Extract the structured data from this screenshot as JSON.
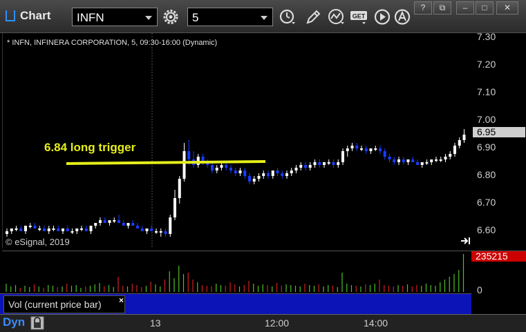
{
  "titlebar": {
    "app_title": "Chart",
    "symbol_value": "INFN",
    "interval_value": "5",
    "get_label": "GET",
    "buttons": [
      "?",
      "⧉",
      "–",
      "□",
      "✕"
    ]
  },
  "chart": {
    "header": "* INFN, INFINERA CORPORATION, 5, 09:30-16:00 (Dynamic)",
    "annotation": "6.84 long trigger",
    "copyright": "© eSignal, 2019",
    "last_price": "6.95",
    "y_ticks": [
      "7.30",
      "7.20",
      "7.10",
      "7.00",
      "6.90",
      "6.80",
      "6.70",
      "6.60"
    ],
    "x_ticks": [
      "13",
      "12:00",
      "14:00"
    ],
    "colors": {
      "up": "#ffffff",
      "down": "#1a3cff",
      "trigger": "#e6ef1a",
      "vol_up": "#4fc22b",
      "vol_down": "#d42020",
      "panel": "#0c14b8"
    }
  },
  "volume": {
    "label": "Vol (current price bar)",
    "last_value": "235215",
    "zero_label": "0"
  },
  "statusbar": {
    "mode": "Dyn"
  },
  "chart_data": {
    "type": "candlestick",
    "price_range": [
      6.55,
      7.32
    ],
    "series": [
      {
        "name": "INFN",
        "values": [
          [
            6.59,
            6.61,
            6.58,
            6.6
          ],
          [
            6.6,
            6.61,
            6.59,
            6.61
          ],
          [
            6.61,
            6.62,
            6.6,
            6.61
          ],
          [
            6.61,
            6.62,
            6.6,
            6.6
          ],
          [
            6.6,
            6.62,
            6.59,
            6.62
          ],
          [
            6.62,
            6.63,
            6.61,
            6.62
          ],
          [
            6.62,
            6.63,
            6.61,
            6.61
          ],
          [
            6.61,
            6.62,
            6.6,
            6.61
          ],
          [
            6.61,
            6.62,
            6.6,
            6.6
          ],
          [
            6.6,
            6.62,
            6.59,
            6.61
          ],
          [
            6.61,
            6.62,
            6.6,
            6.61
          ],
          [
            6.61,
            6.62,
            6.6,
            6.6
          ],
          [
            6.6,
            6.61,
            6.59,
            6.61
          ],
          [
            6.61,
            6.62,
            6.6,
            6.6
          ],
          [
            6.6,
            6.61,
            6.59,
            6.6
          ],
          [
            6.6,
            6.61,
            6.59,
            6.61
          ],
          [
            6.61,
            6.62,
            6.6,
            6.61
          ],
          [
            6.61,
            6.62,
            6.6,
            6.6
          ],
          [
            6.6,
            6.62,
            6.59,
            6.62
          ],
          [
            6.62,
            6.63,
            6.61,
            6.63
          ],
          [
            6.63,
            6.65,
            6.62,
            6.64
          ],
          [
            6.64,
            6.65,
            6.63,
            6.63
          ],
          [
            6.63,
            6.64,
            6.62,
            6.64
          ],
          [
            6.64,
            6.65,
            6.63,
            6.64
          ],
          [
            6.64,
            6.66,
            6.63,
            6.63
          ],
          [
            6.63,
            6.64,
            6.62,
            6.62
          ],
          [
            6.62,
            6.63,
            6.61,
            6.63
          ],
          [
            6.63,
            6.64,
            6.62,
            6.62
          ],
          [
            6.62,
            6.63,
            6.61,
            6.61
          ],
          [
            6.61,
            6.62,
            6.6,
            6.6
          ],
          [
            6.6,
            6.61,
            6.59,
            6.61
          ],
          [
            6.61,
            6.62,
            6.6,
            6.6
          ],
          [
            6.6,
            6.61,
            6.59,
            6.6
          ],
          [
            6.6,
            6.61,
            6.58,
            6.6
          ],
          [
            6.6,
            6.61,
            6.58,
            6.59
          ],
          [
            6.59,
            6.66,
            6.58,
            6.65
          ],
          [
            6.65,
            6.75,
            6.64,
            6.72
          ],
          [
            6.72,
            6.8,
            6.7,
            6.79
          ],
          [
            6.79,
            6.92,
            6.78,
            6.89
          ],
          [
            6.89,
            6.93,
            6.84,
            6.86
          ],
          [
            6.86,
            6.89,
            6.83,
            6.84
          ],
          [
            6.84,
            6.88,
            6.83,
            6.87
          ],
          [
            6.87,
            6.88,
            6.84,
            6.85
          ],
          [
            6.85,
            6.86,
            6.83,
            6.84
          ],
          [
            6.84,
            6.85,
            6.81,
            6.82
          ],
          [
            6.82,
            6.84,
            6.81,
            6.83
          ],
          [
            6.83,
            6.85,
            6.82,
            6.84
          ],
          [
            6.84,
            6.85,
            6.82,
            6.83
          ],
          [
            6.83,
            6.84,
            6.81,
            6.82
          ],
          [
            6.82,
            6.83,
            6.8,
            6.81
          ],
          [
            6.81,
            6.83,
            6.8,
            6.82
          ],
          [
            6.82,
            6.83,
            6.79,
            6.8
          ],
          [
            6.8,
            6.81,
            6.77,
            6.78
          ],
          [
            6.78,
            6.8,
            6.77,
            6.79
          ],
          [
            6.79,
            6.81,
            6.78,
            6.8
          ],
          [
            6.8,
            6.82,
            6.79,
            6.81
          ],
          [
            6.81,
            6.82,
            6.79,
            6.8
          ],
          [
            6.8,
            6.82,
            6.79,
            6.82
          ],
          [
            6.82,
            6.83,
            6.8,
            6.81
          ],
          [
            6.81,
            6.82,
            6.79,
            6.8
          ],
          [
            6.8,
            6.82,
            6.79,
            6.81
          ],
          [
            6.81,
            6.83,
            6.8,
            6.82
          ],
          [
            6.82,
            6.84,
            6.81,
            6.83
          ],
          [
            6.83,
            6.85,
            6.82,
            6.84
          ],
          [
            6.84,
            6.85,
            6.82,
            6.83
          ],
          [
            6.83,
            6.85,
            6.82,
            6.84
          ],
          [
            6.84,
            6.86,
            6.83,
            6.85
          ],
          [
            6.85,
            6.86,
            6.83,
            6.84
          ],
          [
            6.84,
            6.85,
            6.83,
            6.85
          ],
          [
            6.85,
            6.86,
            6.84,
            6.85
          ],
          [
            6.85,
            6.86,
            6.83,
            6.84
          ],
          [
            6.84,
            6.86,
            6.83,
            6.85
          ],
          [
            6.85,
            6.9,
            6.84,
            6.89
          ],
          [
            6.89,
            6.91,
            6.87,
            6.9
          ],
          [
            6.9,
            6.92,
            6.89,
            6.91
          ],
          [
            6.91,
            6.92,
            6.89,
            6.9
          ],
          [
            6.9,
            6.91,
            6.89,
            6.9
          ],
          [
            6.9,
            6.91,
            6.88,
            6.89
          ],
          [
            6.89,
            6.9,
            6.88,
            6.9
          ],
          [
            6.9,
            6.91,
            6.89,
            6.9
          ],
          [
            6.9,
            6.91,
            6.88,
            6.89
          ],
          [
            6.89,
            6.9,
            6.86,
            6.87
          ],
          [
            6.87,
            6.88,
            6.85,
            6.86
          ],
          [
            6.86,
            6.87,
            6.84,
            6.85
          ],
          [
            6.85,
            6.87,
            6.84,
            6.86
          ],
          [
            6.86,
            6.87,
            6.84,
            6.85
          ],
          [
            6.85,
            6.86,
            6.84,
            6.86
          ],
          [
            6.86,
            6.87,
            6.85,
            6.85
          ],
          [
            6.85,
            6.86,
            6.84,
            6.84
          ],
          [
            6.84,
            6.85,
            6.83,
            6.85
          ],
          [
            6.85,
            6.86,
            6.84,
            6.85
          ],
          [
            6.85,
            6.86,
            6.84,
            6.86
          ],
          [
            6.86,
            6.87,
            6.85,
            6.86
          ],
          [
            6.86,
            6.87,
            6.85,
            6.86
          ],
          [
            6.86,
            6.88,
            6.85,
            6.87
          ],
          [
            6.87,
            6.89,
            6.86,
            6.88
          ],
          [
            6.88,
            6.92,
            6.87,
            6.91
          ],
          [
            6.91,
            6.94,
            6.9,
            6.93
          ],
          [
            6.93,
            6.97,
            6.92,
            6.95
          ]
        ]
      },
      {
        "name": "Vol (current price bar)",
        "values": [
          12,
          8,
          10,
          6,
          9,
          7,
          11,
          8,
          6,
          10,
          9,
          7,
          8,
          12,
          9,
          10,
          6,
          8,
          9,
          11,
          13,
          8,
          10,
          7,
          22,
          9,
          8,
          12,
          10,
          7,
          9,
          15,
          11,
          8,
          18,
          30,
          20,
          38,
          26,
          28,
          18,
          14,
          10,
          9,
          8,
          12,
          10,
          9,
          14,
          11,
          8,
          10,
          16,
          12,
          9,
          11,
          10,
          8,
          13,
          9,
          11,
          10,
          9,
          8,
          12,
          10,
          9,
          11,
          8,
          10,
          9,
          7,
          28,
          12,
          10,
          9,
          8,
          11,
          10,
          12,
          18,
          10,
          9,
          8,
          10,
          9,
          11,
          8,
          10,
          9,
          12,
          10,
          9,
          14,
          18,
          22,
          26,
          32,
          55
        ]
      }
    ]
  }
}
